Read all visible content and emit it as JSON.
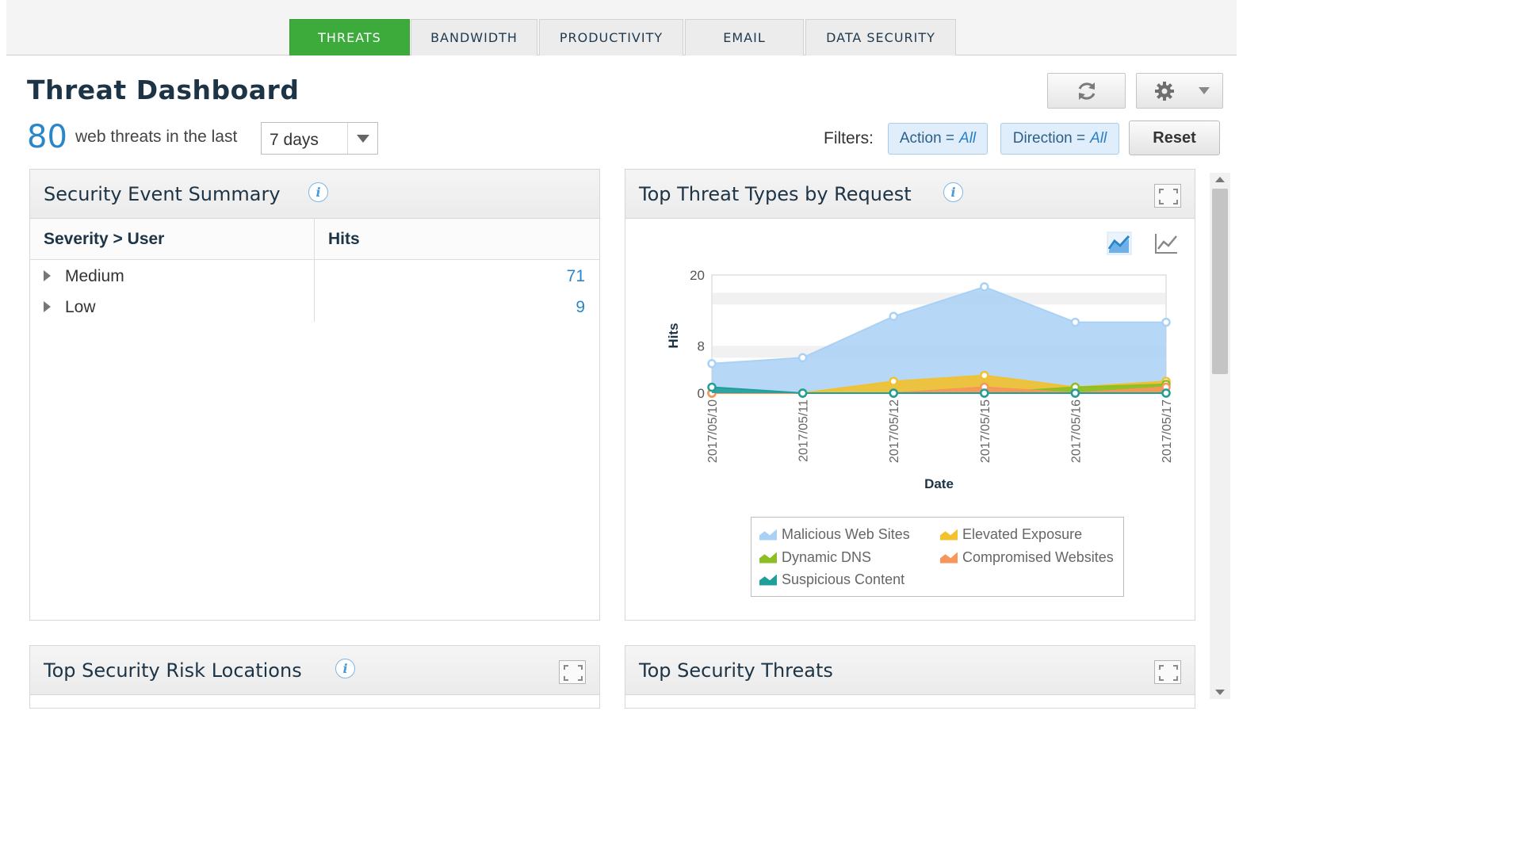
{
  "tabs": [
    {
      "label": "THREATS",
      "active": true
    },
    {
      "label": "BANDWIDTH",
      "active": false
    },
    {
      "label": "PRODUCTIVITY",
      "active": false
    },
    {
      "label": "EMAIL",
      "active": false
    },
    {
      "label": "DATA SECURITY",
      "active": false
    }
  ],
  "header": {
    "title": "Threat Dashboard",
    "threat_count": "80",
    "count_text": "web threats in the last",
    "period": "7 days",
    "refresh_icon": "refresh-icon",
    "settings_icon": "gear-icon"
  },
  "filters": {
    "label": "Filters:",
    "action_key": "Action =",
    "action_value": "All",
    "direction_key": "Direction =",
    "direction_value": "All",
    "reset_label": "Reset"
  },
  "summary": {
    "title": "Security Event Summary",
    "col_user": "Severity > User",
    "col_hits": "Hits",
    "rows": [
      {
        "label": "Medium",
        "hits": "71"
      },
      {
        "label": "Low",
        "hits": "9"
      }
    ]
  },
  "threat_types": {
    "title": "Top Threat Types by Request",
    "area_icon": "area-chart-icon",
    "line_icon": "line-chart-icon"
  },
  "chart_data": {
    "type": "area",
    "title": "",
    "xlabel": "Date",
    "ylabel": "Hits",
    "x": [
      "2017/05/10",
      "2017/05/11",
      "2017/05/12",
      "2017/05/15",
      "2017/05/16",
      "2017/05/17"
    ],
    "y_ticks": [
      "20",
      "8",
      "0"
    ],
    "legend": "bottom",
    "series": [
      {
        "name": "Malicious Web Sites",
        "color": "#a9d1f5",
        "values": [
          5,
          6,
          13,
          18,
          12,
          12
        ]
      },
      {
        "name": "Elevated Exposure",
        "color": "#f2c12e",
        "values": [
          0,
          0,
          2,
          3,
          1,
          2
        ]
      },
      {
        "name": "Dynamic DNS",
        "color": "#8cbf26",
        "values": [
          0,
          0,
          0,
          0,
          1,
          1.5
        ]
      },
      {
        "name": "Compromised Websites",
        "color": "#f7955b",
        "values": [
          0,
          0,
          0,
          1,
          0,
          1
        ]
      },
      {
        "name": "Suspicious Content",
        "color": "#1f9e9a",
        "values": [
          1,
          0,
          0,
          0,
          0,
          0
        ]
      }
    ]
  },
  "risk_locations": {
    "title": "Top Security Risk Locations"
  },
  "security_threats": {
    "title": "Top Security Threats"
  }
}
